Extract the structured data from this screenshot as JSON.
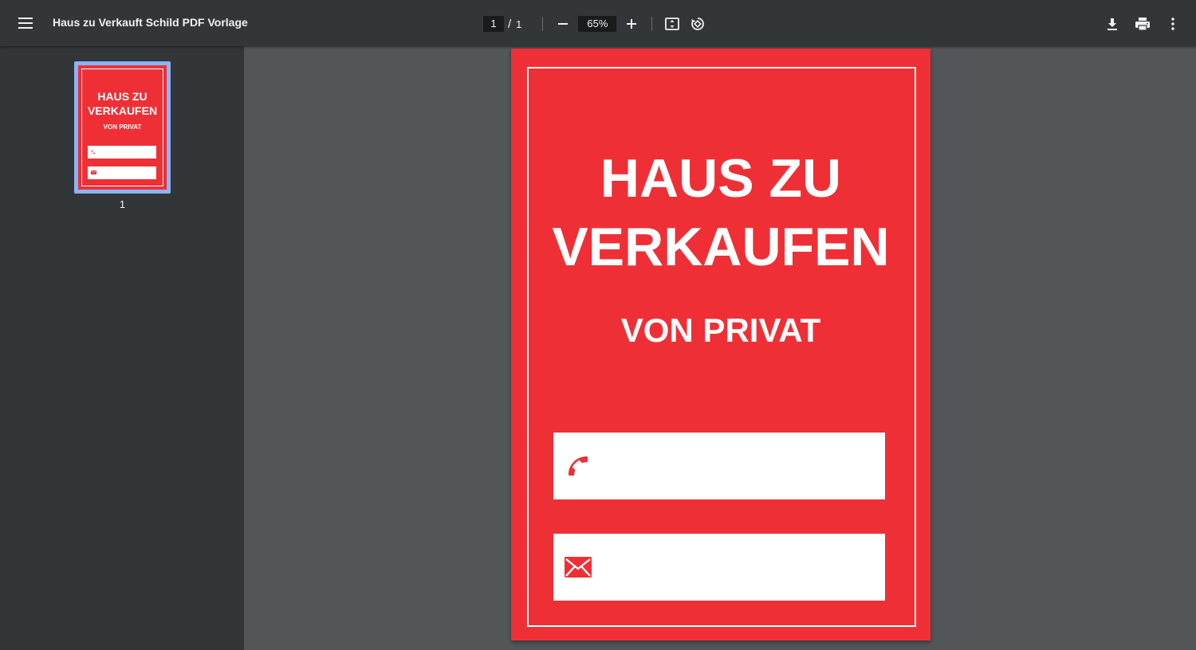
{
  "toolbar": {
    "title": "Haus zu Verkauft Schild PDF Vorlage",
    "current_page": "1",
    "page_separator": "/",
    "total_pages": "1",
    "zoom": "65%",
    "icons": [
      "menu-icon",
      "zoom-out-icon",
      "zoom-in-icon",
      "fit-page-icon",
      "rotate-icon",
      "download-icon",
      "print-icon",
      "more-icon"
    ]
  },
  "sidebar": {
    "thumbnails": [
      {
        "page_number": "1",
        "title_line1": "HAUS ZU",
        "title_line2": "VERKAUFEN",
        "subtitle": "VON PRIVAT"
      }
    ]
  },
  "document": {
    "title_line1": "HAUS ZU",
    "title_line2": "VERKAUFEN",
    "subtitle": "VON PRIVAT",
    "fields": [
      {
        "icon": "phone-icon",
        "value": ""
      },
      {
        "icon": "envelope-icon",
        "value": ""
      }
    ]
  },
  "colors": {
    "toolbar_bg": "#323639",
    "viewer_bg": "#525659",
    "sign_red": "#ee3036",
    "thumb_highlight": "#8ab4f8"
  }
}
